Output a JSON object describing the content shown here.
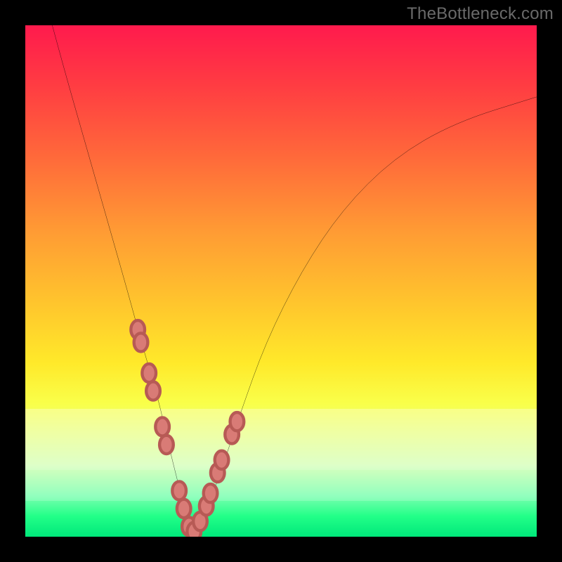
{
  "watermark": "TheBottleneck.com",
  "chart_data": {
    "type": "line",
    "title": "",
    "xlabel": "",
    "ylabel": "",
    "xlim": [
      0,
      100
    ],
    "ylim": [
      0,
      100
    ],
    "series": [
      {
        "name": "bottleneck-curve",
        "x": [
          5,
          8,
          12,
          16,
          20,
          23,
          26,
          28,
          30,
          31.5,
          33,
          35,
          38,
          42,
          47,
          54,
          62,
          72,
          84,
          100
        ],
        "y": [
          101,
          90,
          76,
          62,
          48,
          37,
          27,
          18,
          10,
          4,
          0,
          4,
          12,
          24,
          38,
          52,
          64,
          74,
          81,
          86
        ]
      }
    ],
    "marker_points": {
      "name": "highlight-dots",
      "x": [
        22.0,
        22.6,
        24.2,
        25.0,
        26.8,
        27.6,
        30.1,
        31.0,
        32.0,
        33.0,
        34.2,
        35.4,
        36.2,
        37.6,
        38.4,
        40.4,
        41.4
      ],
      "y": [
        40.5,
        38.0,
        32.0,
        28.5,
        21.5,
        18.0,
        9.0,
        5.5,
        2.0,
        1.0,
        3.0,
        6.0,
        8.5,
        12.5,
        15.0,
        20.0,
        22.5
      ]
    },
    "gradient_stops": [
      {
        "pos": 0.0,
        "color": "#ff1a4d"
      },
      {
        "pos": 0.12,
        "color": "#ff3d42"
      },
      {
        "pos": 0.26,
        "color": "#ff6a3a"
      },
      {
        "pos": 0.4,
        "color": "#ff9a34"
      },
      {
        "pos": 0.54,
        "color": "#ffc42d"
      },
      {
        "pos": 0.66,
        "color": "#ffe92a"
      },
      {
        "pos": 0.74,
        "color": "#f9ff4a"
      },
      {
        "pos": 0.8,
        "color": "#e7ff80"
      },
      {
        "pos": 0.86,
        "color": "#d0ffb0"
      },
      {
        "pos": 0.92,
        "color": "#7bffb0"
      },
      {
        "pos": 0.96,
        "color": "#22ff88"
      },
      {
        "pos": 1.0,
        "color": "#00e87a"
      }
    ]
  }
}
